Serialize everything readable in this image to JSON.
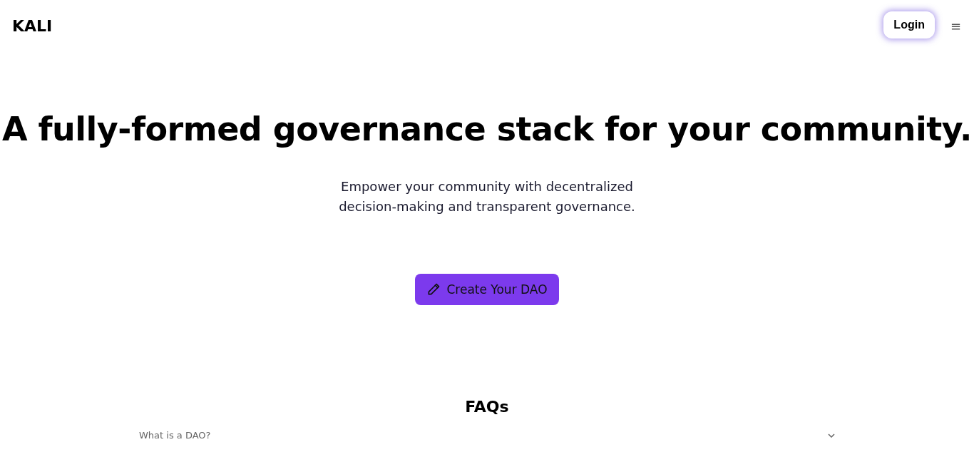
{
  "header": {
    "logo": "KALI",
    "login_button": "Login",
    "menu_icon": "≡"
  },
  "hero": {
    "headline": "A fully-formed governance stack for your community.",
    "subtitle": "Empower your community with decentralized decision-making and transparent governance.",
    "cta_button": "Create Your DAO"
  },
  "faqs": {
    "title": "FAQs",
    "items": [
      {
        "question": "What is a DAO?",
        "expanded": false
      }
    ]
  }
}
